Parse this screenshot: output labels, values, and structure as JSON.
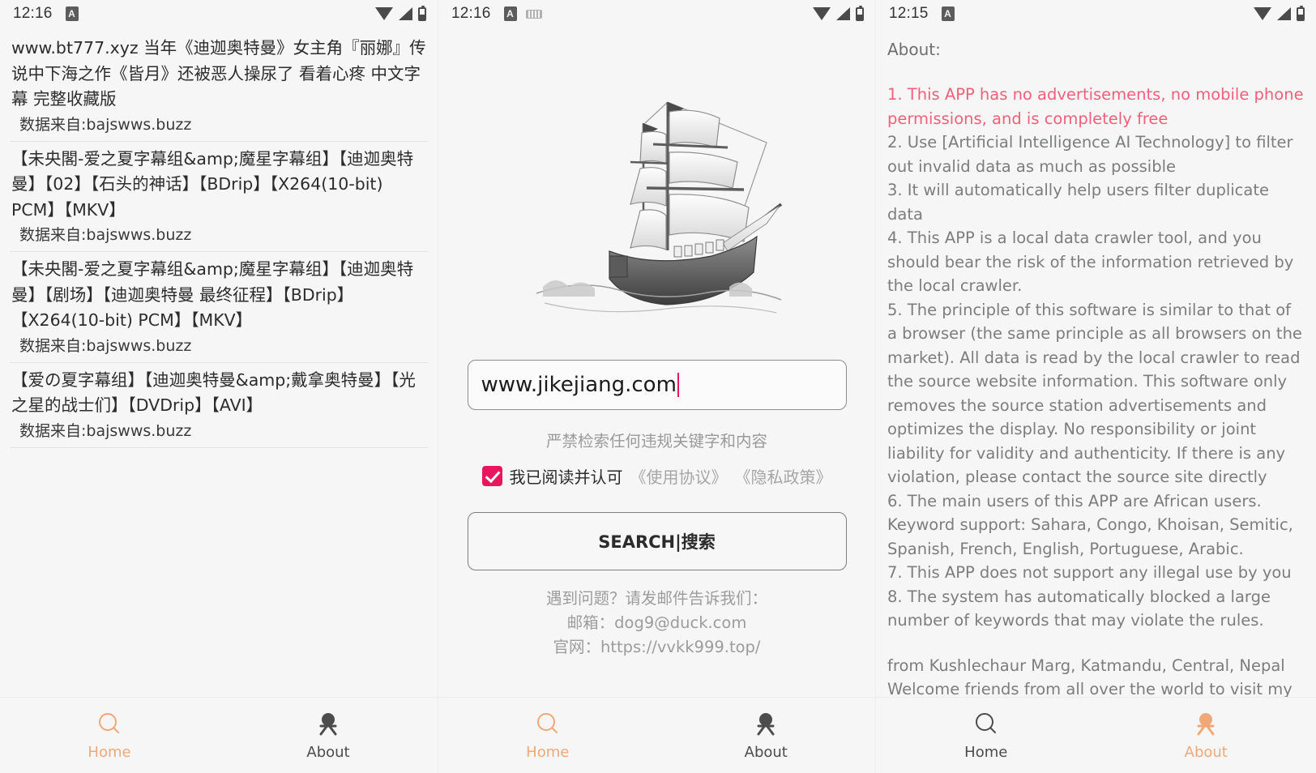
{
  "colors": {
    "accent_active": "#f0a878",
    "tab_inactive": "#4c4c4c",
    "checkbox": "#e8175d",
    "caret": "#e8175d",
    "highlight_text": "#f0607a",
    "body_text": "#7d7d7d"
  },
  "screens": [
    {
      "id": "results",
      "statusbar": {
        "time": "12:16",
        "left_icons": [
          "app-badge-icon"
        ],
        "right_icons": [
          "wifi-icon",
          "signal-icon",
          "battery-icon"
        ]
      },
      "results": [
        {
          "title": "www.bt777.xyz 当年《迪迦奥特曼》女主角『丽娜』传说中下海之作《皆月》还被恶人操尿了 看着心疼 中文字幕 完整收藏版",
          "source": "数据来自:bajswws.buzz"
        },
        {
          "title": "【未央閣-爱之夏字幕组&amp;魔星字幕组】【迪迦奥特曼】【02】【石头的神话】【BDrip】【X264(10-bit) PCM】【MKV】",
          "source": "数据来自:bajswws.buzz"
        },
        {
          "title": "【未央閣-爱之夏字幕组&amp;魔星字幕组】【迪迦奥特曼】【剧场】【迪迦奥特曼 最终征程】【BDrip】【X264(10-bit) PCM】【MKV】",
          "source": "数据来自:bajswws.buzz"
        },
        {
          "title": "【爱の夏字幕组】【迪迦奥特曼&amp;戴拿奥特曼】【光之星的战士们】【DVDrip】【AVI】",
          "source": "数据来自:bajswws.buzz"
        }
      ],
      "tabs": [
        {
          "label": "Home",
          "icon": "search-icon",
          "active": true
        },
        {
          "label": "About",
          "icon": "person-icon",
          "active": false
        }
      ]
    },
    {
      "id": "home",
      "statusbar": {
        "time": "12:16",
        "left_icons": [
          "app-badge-icon",
          "keyboard-icon"
        ],
        "right_icons": [
          "wifi-icon",
          "signal-icon",
          "battery-icon"
        ]
      },
      "hero_icon": "sailing-ship-illustration",
      "search": {
        "value": "www.jikejiang.com",
        "placeholder": "www.jikejiang.com",
        "warning": "严禁检索任何违规关键字和内容",
        "agree_checked": true,
        "agree_text": "我已阅读并认可",
        "agreement_link": "《使用协议》",
        "privacy_link": "《隐私政策》",
        "button_label": "SEARCH|搜索"
      },
      "contact": {
        "line1": "遇到问题？请发邮件告诉我们：",
        "line2": "邮箱：dog9@duck.com",
        "line3": "官网：https://vvkk999.top/"
      },
      "tabs": [
        {
          "label": "Home",
          "icon": "search-icon",
          "active": true
        },
        {
          "label": "About",
          "icon": "person-icon",
          "active": false
        }
      ]
    },
    {
      "id": "about",
      "statusbar": {
        "time": "12:15",
        "left_icons": [
          "app-badge-icon"
        ],
        "right_icons": [
          "wifi-icon",
          "signal-icon",
          "battery-icon"
        ]
      },
      "about": {
        "heading": "About:",
        "items": [
          {
            "text": "1. This APP has no advertisements, no mobile phone permissions, and is completely free",
            "highlight": true
          },
          {
            "text": "2. Use [Artificial Intelligence AI Technology] to filter out invalid data as much as possible",
            "highlight": false
          },
          {
            "text": "3. It will automatically help users filter duplicate data",
            "highlight": false
          },
          {
            "text": "4. This APP is a local data crawler tool, and you should bear the risk of the information retrieved by the local crawler.",
            "highlight": false
          },
          {
            "text": "5. The principle of this software is similar to that of a browser (the same principle as all browsers on the market). All data is read by the local crawler to read the source website information. This software only removes the source station advertisements and optimizes the display. No responsibility or joint liability for validity and authenticity. If there is any violation, please contact the source site directly",
            "highlight": false
          },
          {
            "text": "6. The main users of this APP are African users. Keyword support: Sahara, Congo, Khoisan, Semitic, Spanish, French, English, Portuguese, Arabic.",
            "highlight": false
          },
          {
            "text": "7. This APP does not support any illegal use by you",
            "highlight": false
          },
          {
            "text": "8. The system has automatically blocked a large number of keywords that may violate the rules.",
            "highlight": false
          }
        ],
        "footer": [
          "from Kushlechaur Marg, Katmandu, Central, Nepal",
          "Welcome friends from all over the world to visit my country and my city"
        ]
      },
      "tabs": [
        {
          "label": "Home",
          "icon": "search-icon",
          "active": false
        },
        {
          "label": "About",
          "icon": "person-icon",
          "active": true
        }
      ]
    }
  ]
}
